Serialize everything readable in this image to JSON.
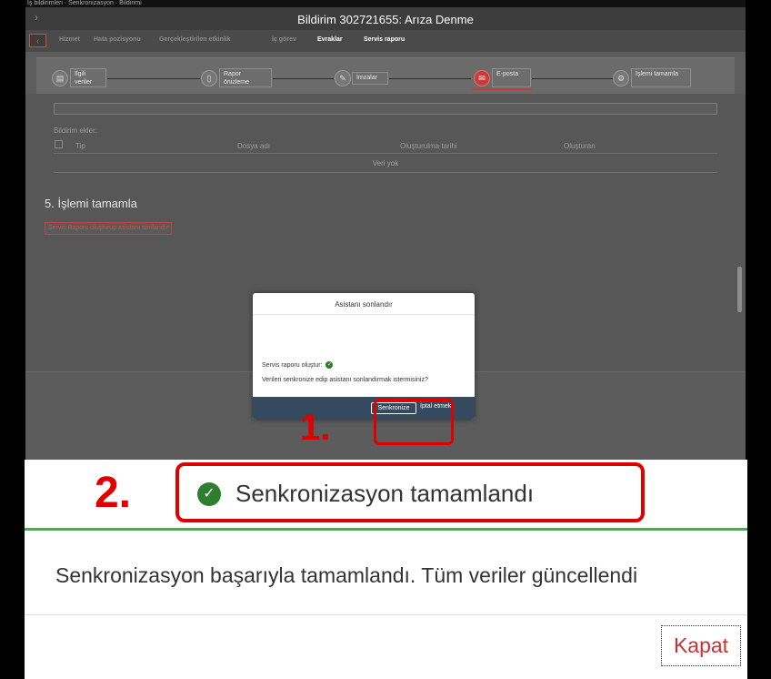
{
  "shell": {
    "breadcrumb": "İş bildirimleri · Senkronizasyon · Bildirimi",
    "title": "Bildirim 302721655: Arıza Denme"
  },
  "tabs": [
    {
      "label": "Hizmet"
    },
    {
      "label": "Hata pozisyonu"
    },
    {
      "label": "Gerçekleştirilen etkinlik"
    },
    {
      "label": "İç görev"
    },
    {
      "label": "Evraklar"
    },
    {
      "label": "Servis raporu"
    }
  ],
  "steps": [
    {
      "icon": "table-icon",
      "label": "İlgili veriler"
    },
    {
      "icon": "document-icon",
      "label": "Rapor önizleme"
    },
    {
      "icon": "pen-icon",
      "label": "İmzalar"
    },
    {
      "icon": "email-icon",
      "label": "E-posta"
    },
    {
      "icon": "finish-icon",
      "label": "İşlemi tamamla"
    }
  ],
  "attachments": {
    "label": "Bildirim ekler:",
    "columns": [
      "Tip",
      "Dosya adı",
      "Oluşturulma tarihi",
      "Oluşturan"
    ],
    "empty_text": "Veri yok"
  },
  "section": {
    "title": "5. İşlemi tamamla",
    "button": "Servis Raporu oluşturup asistanı sonlandır"
  },
  "dialog": {
    "title": "Asistanı sonlandır",
    "line1": "Servis raporu oluştur:",
    "line2": "Verileri senkronize edip asistanı sonlandırmak istermisiniz?",
    "confirm": "Senkronize",
    "cancel": "İptal etmek"
  },
  "annotations": {
    "step1": "1.",
    "step2": "2."
  },
  "toast": {
    "title": "Senkronizasyon tamamlandı",
    "message": "Senkronizasyon başarıyla tamamlandı. Tüm veriler güncellendi",
    "close": "Kapat"
  },
  "colors": {
    "accent_red": "#e00000",
    "success_green": "#2f7d2f",
    "dialog_footer": "#354a5f"
  }
}
